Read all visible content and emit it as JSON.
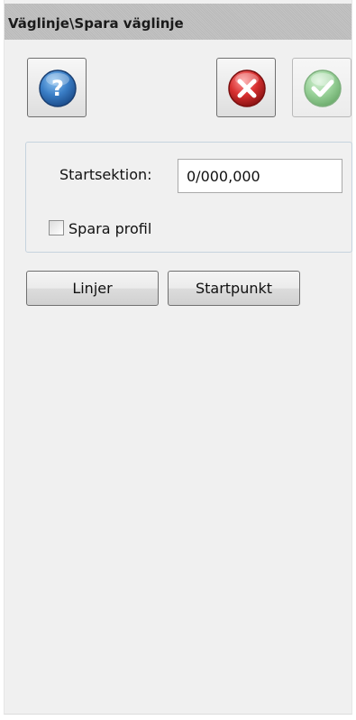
{
  "title": "Väglinje\\Spara väglinje",
  "toolbar": {
    "help_icon": "help-icon",
    "cancel_icon": "cancel-icon",
    "ok_icon": "check-icon",
    "ok_enabled": false
  },
  "form": {
    "start_section_label": "Startsektion:",
    "start_section_value": "0/000,000",
    "save_profile_label": "Spara profil",
    "save_profile_checked": false
  },
  "buttons": {
    "lines_label": "Linjer",
    "start_point_label": "Startpunkt"
  },
  "colors": {
    "help_blue": "#2f6fb6",
    "cancel_red": "#d83030",
    "ok_green_disabled": "#88c888",
    "panel_bg": "#f0f0f0"
  }
}
